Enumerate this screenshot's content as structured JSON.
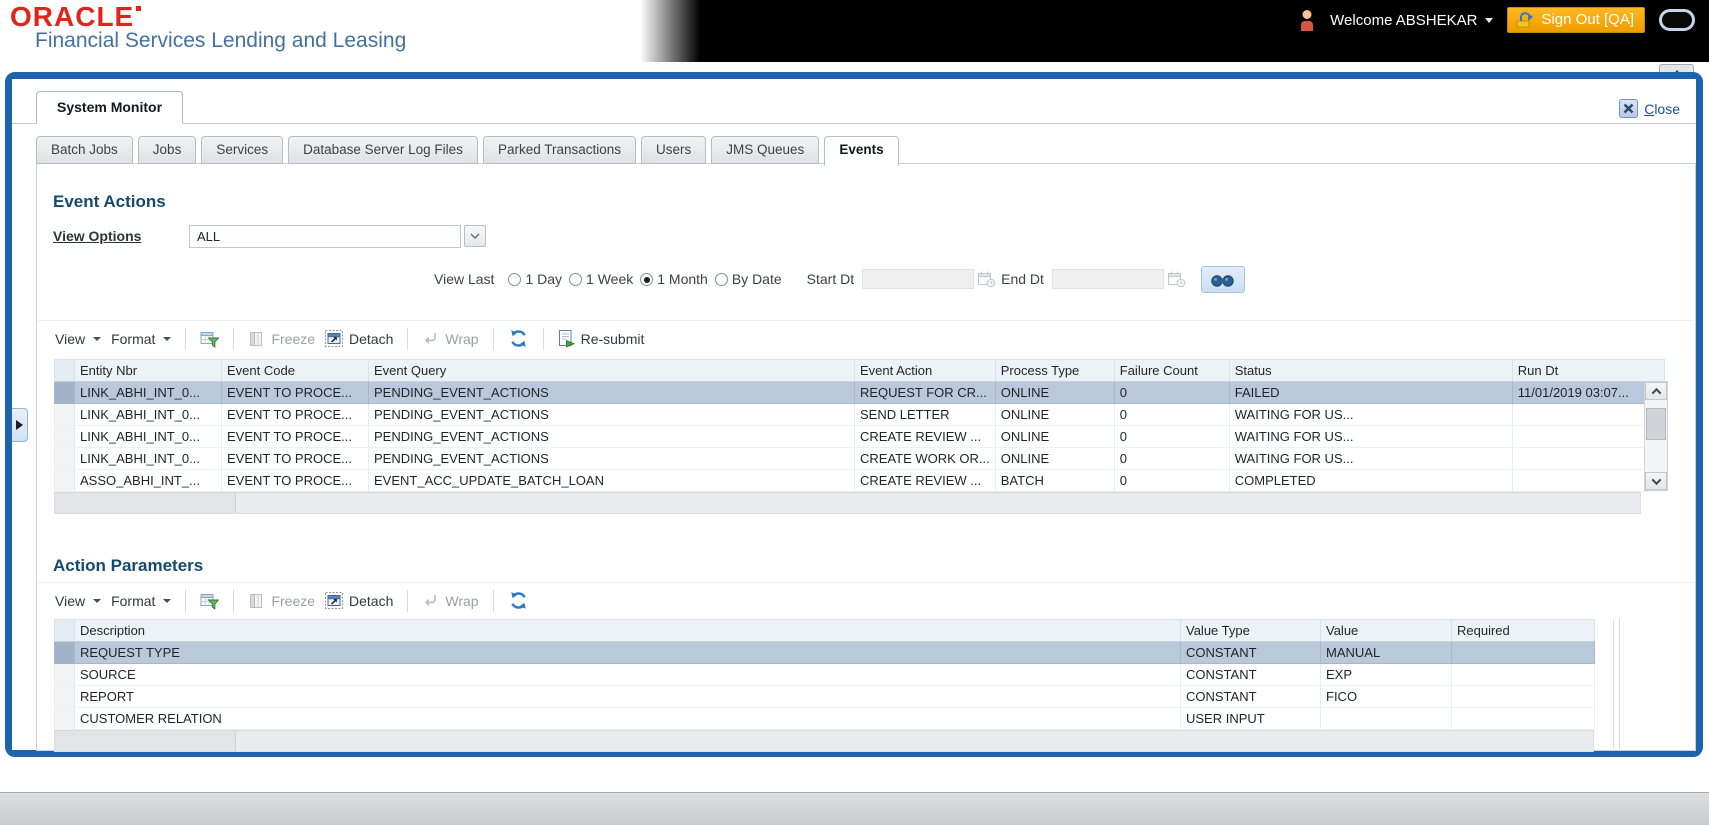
{
  "colors": {
    "oracle_red": "#e2231a",
    "subtitle_blue": "#44719f",
    "header_bg": "#000000",
    "signout_orange": "#f09c00",
    "frame_blue": "#1e63ae",
    "section_title_blue": "#164a6d",
    "selected_row": "#b9c8db",
    "table_header_bg": "#edf2f8"
  },
  "header": {
    "logo": "ORACLE",
    "subtitle": "Financial Services Lending and Leasing",
    "welcome": "Welcome ABSHEKAR",
    "sign_out": "Sign Out [QA]"
  },
  "window": {
    "title_tab": "System Monitor",
    "close_label": "Close"
  },
  "tabs": [
    {
      "label": "Batch Jobs",
      "active": false
    },
    {
      "label": "Jobs",
      "active": false
    },
    {
      "label": "Services",
      "active": false
    },
    {
      "label": "Database Server Log Files",
      "active": false
    },
    {
      "label": "Parked Transactions",
      "active": false
    },
    {
      "label": "Users",
      "active": false
    },
    {
      "label": "JMS Queues",
      "active": false
    },
    {
      "label": "Events",
      "active": true
    }
  ],
  "event_actions": {
    "title": "Event Actions",
    "view_options": {
      "label": "View Options",
      "value": "ALL"
    },
    "filters": {
      "view_last_label": "View Last",
      "options": [
        {
          "label": "1 Day",
          "selected": false
        },
        {
          "label": "1 Week",
          "selected": false
        },
        {
          "label": "1 Month",
          "selected": true
        },
        {
          "label": "By Date",
          "selected": false
        }
      ],
      "start_dt_label": "Start Dt",
      "start_dt_value": "",
      "end_dt_label": "End Dt",
      "end_dt_value": ""
    },
    "toolbar": [
      {
        "type": "menu",
        "name": "view-menu-button",
        "label": "View"
      },
      {
        "type": "menu",
        "name": "format-menu-button",
        "label": "Format"
      },
      {
        "type": "sep"
      },
      {
        "type": "iconbtn",
        "name": "query-by-example-button",
        "icon": "qbe-icon",
        "enabled": true
      },
      {
        "type": "sep"
      },
      {
        "type": "btn",
        "name": "freeze-button",
        "icon": "freeze-icon",
        "label": "Freeze",
        "enabled": false
      },
      {
        "type": "btn",
        "name": "detach-button",
        "icon": "detach-icon",
        "label": "Detach",
        "enabled": true
      },
      {
        "type": "sep"
      },
      {
        "type": "btn",
        "name": "wrap-button",
        "icon": "wrap-icon",
        "label": "Wrap",
        "enabled": false
      },
      {
        "type": "sep"
      },
      {
        "type": "iconbtn",
        "name": "refresh-button",
        "icon": "refresh-icon",
        "enabled": true
      },
      {
        "type": "sep"
      },
      {
        "type": "btn",
        "name": "resubmit-button",
        "icon": "resubmit-icon",
        "label": "Re-submit",
        "enabled": true
      }
    ],
    "table": {
      "columns": [
        "Entity Nbr",
        "Event Code",
        "Event Query",
        "Event Action",
        "Process Type",
        "Failure Count",
        "Status",
        "Run Dt"
      ],
      "rows": [
        [
          "LINK_ABHI_INT_0...",
          "EVENT TO PROCE...",
          "PENDING_EVENT_ACTIONS",
          "REQUEST FOR CR...",
          "ONLINE",
          "0",
          "FAILED",
          "11/01/2019 03:07..."
        ],
        [
          "LINK_ABHI_INT_0...",
          "EVENT TO PROCE...",
          "PENDING_EVENT_ACTIONS",
          "SEND LETTER",
          "ONLINE",
          "0",
          "WAITING FOR US...",
          ""
        ],
        [
          "LINK_ABHI_INT_0...",
          "EVENT TO PROCE...",
          "PENDING_EVENT_ACTIONS",
          "CREATE REVIEW ...",
          "ONLINE",
          "0",
          "WAITING FOR US...",
          ""
        ],
        [
          "LINK_ABHI_INT_0...",
          "EVENT TO PROCE...",
          "PENDING_EVENT_ACTIONS",
          "CREATE WORK OR...",
          "ONLINE",
          "0",
          "WAITING FOR US...",
          ""
        ],
        [
          "ASSO_ABHI_INT_...",
          "EVENT TO PROCE...",
          "EVENT_ACC_UPDATE_BATCH_LOAN",
          "CREATE REVIEW ...",
          "BATCH",
          "0",
          "COMPLETED",
          ""
        ]
      ],
      "selected_row": 0
    }
  },
  "action_parameters": {
    "title": "Action Parameters",
    "toolbar": [
      {
        "type": "menu",
        "name": "view-menu-button",
        "label": "View"
      },
      {
        "type": "menu",
        "name": "format-menu-button",
        "label": "Format"
      },
      {
        "type": "sep"
      },
      {
        "type": "iconbtn",
        "name": "query-by-example-button",
        "icon": "qbe-icon",
        "enabled": true
      },
      {
        "type": "sep"
      },
      {
        "type": "btn",
        "name": "freeze-button",
        "icon": "freeze-icon",
        "label": "Freeze",
        "enabled": false
      },
      {
        "type": "btn",
        "name": "detach-button",
        "icon": "detach-icon",
        "label": "Detach",
        "enabled": true
      },
      {
        "type": "sep"
      },
      {
        "type": "btn",
        "name": "wrap-button",
        "icon": "wrap-icon",
        "label": "Wrap",
        "enabled": false
      },
      {
        "type": "sep"
      },
      {
        "type": "iconbtn",
        "name": "refresh-button",
        "icon": "refresh-icon",
        "enabled": true
      }
    ],
    "table": {
      "columns": [
        "Description",
        "Value Type",
        "Value",
        "Required"
      ],
      "rows": [
        [
          "REQUEST TYPE",
          "CONSTANT",
          "MANUAL",
          ""
        ],
        [
          "SOURCE",
          "CONSTANT",
          "EXP",
          ""
        ],
        [
          "REPORT",
          "CONSTANT",
          "FICO",
          ""
        ],
        [
          "CUSTOMER RELATION",
          "USER INPUT",
          "",
          ""
        ]
      ],
      "selected_row": 0
    }
  }
}
